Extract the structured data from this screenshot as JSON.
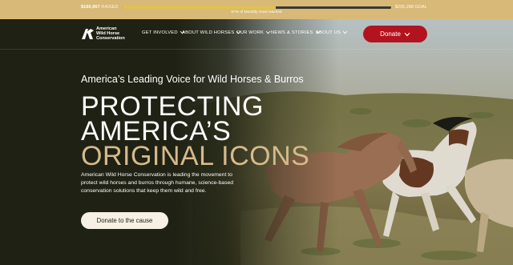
{
  "announcement": {
    "raised_amount": "$160,967",
    "raised_suffix": "RAISED",
    "goal_text": "$295,288 GOAL",
    "progress_fraction": 0.57,
    "progress_label": "57% of Monthly Goal reached"
  },
  "header": {
    "logo": {
      "line1": "American",
      "line2": "Wild Horse",
      "line3": "Conservation"
    },
    "nav": [
      {
        "label": "GET INVOLVED",
        "icon": "chevron-down-icon"
      },
      {
        "label": "ABOUT WILD HORSES",
        "icon": "chevron-down-icon"
      },
      {
        "label": "OUR WORK",
        "icon": "chevron-down-icon"
      },
      {
        "label": "NEWS & STORIES",
        "icon": "chevron-down-icon"
      },
      {
        "label": "ABOUT US",
        "icon": "chevron-down-icon"
      }
    ],
    "donate_label": "Donate"
  },
  "hero": {
    "tagline": "America’s Leading Voice for Wild Horses & Burros",
    "headline": {
      "line1": "PROTECTING",
      "line2": "AMERICA’S",
      "line3": "ORIGINAL ICONS"
    },
    "description": "American Wild Horse Conservation is leading the movement to protect wild horses and burros through humane, science-based conservation solutions that keep them wild and free.",
    "cta_label": "Donate to the cause"
  },
  "colors": {
    "topbar": "#d9b978",
    "background": "#1e2113",
    "donate_button": "#b3131e",
    "headline_accent": "#d6ba8a",
    "cta_button": "#f7f0e4"
  }
}
